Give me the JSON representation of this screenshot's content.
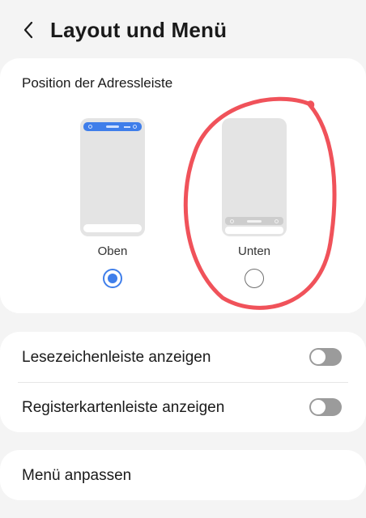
{
  "header": {
    "title": "Layout und Menü",
    "back_icon": "chevron-left-icon"
  },
  "address_bar_position": {
    "section_title": "Position der Adressleiste",
    "options": [
      {
        "label": "Oben",
        "selected": true
      },
      {
        "label": "Unten",
        "selected": false
      }
    ]
  },
  "toggles": [
    {
      "label": "Lesezeichenleiste anzeigen",
      "on": false
    },
    {
      "label": "Registerkartenleiste anzeigen",
      "on": false
    }
  ],
  "menu": {
    "label": "Menü anpassen"
  },
  "colors": {
    "accent": "#3f7eea",
    "background": "#f4f4f4",
    "card": "#ffffff",
    "annotation": "#f0525a",
    "toggle_off": "#9b9b9b"
  }
}
